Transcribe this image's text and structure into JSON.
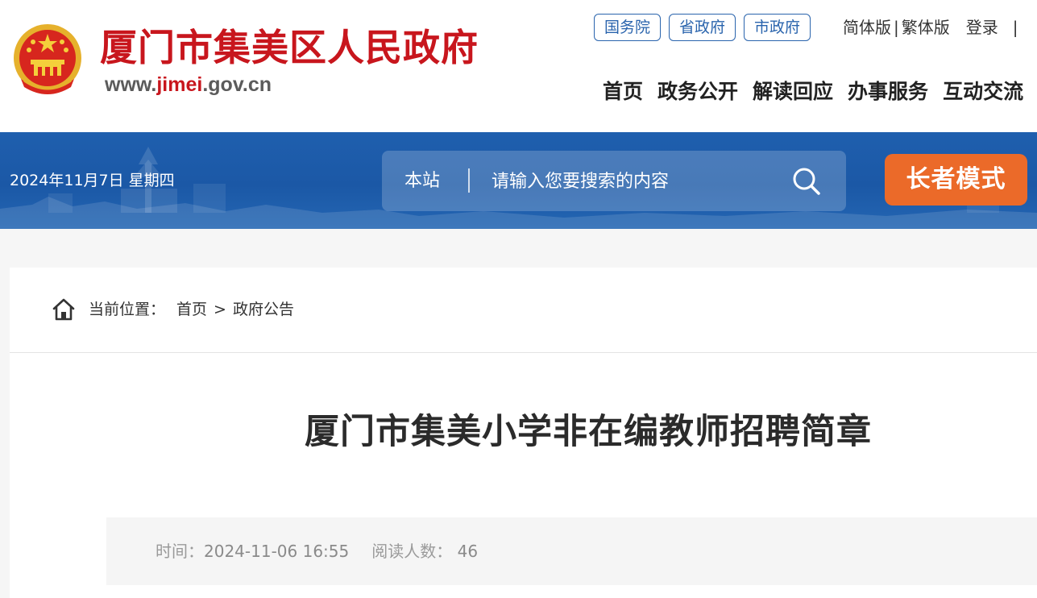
{
  "header": {
    "site_name": "厦门市集美区人民政府",
    "site_url_prefix": "www.",
    "site_url_accent": "jimei",
    "site_url_suffix": ".gov.cn",
    "gov_links": [
      "国务院",
      "省政府",
      "市政府"
    ],
    "lang_simplified": "简体版",
    "lang_separator": "|",
    "lang_traditional": "繁体版",
    "login": "登录",
    "trailing_bar": "|",
    "nav": [
      "首页",
      "政务公开",
      "解读回应",
      "办事服务",
      "互动交流"
    ]
  },
  "banner": {
    "date": "2024年11月7日 星期四",
    "search_scope": "本站",
    "search_placeholder": "请输入您要搜索的内容",
    "elder_mode": "长者模式"
  },
  "breadcrumb": {
    "label": "当前位置：",
    "home": "首页",
    "separator": ">",
    "current": "政府公告"
  },
  "article": {
    "title": "厦门市集美小学非在编教师招聘简章",
    "time_label": "时间：",
    "time_value": "2024-11-06 16:55",
    "reads_label": "阅读人数：",
    "reads_value": "46"
  },
  "colors": {
    "brand_red": "#c8161d",
    "link_blue": "#2a64ad",
    "banner_blue": "#1b58a6",
    "elder_orange": "#eb6a29"
  },
  "icons": {
    "emblem": "national-emblem-icon",
    "search": "search-icon",
    "home": "home-icon"
  }
}
